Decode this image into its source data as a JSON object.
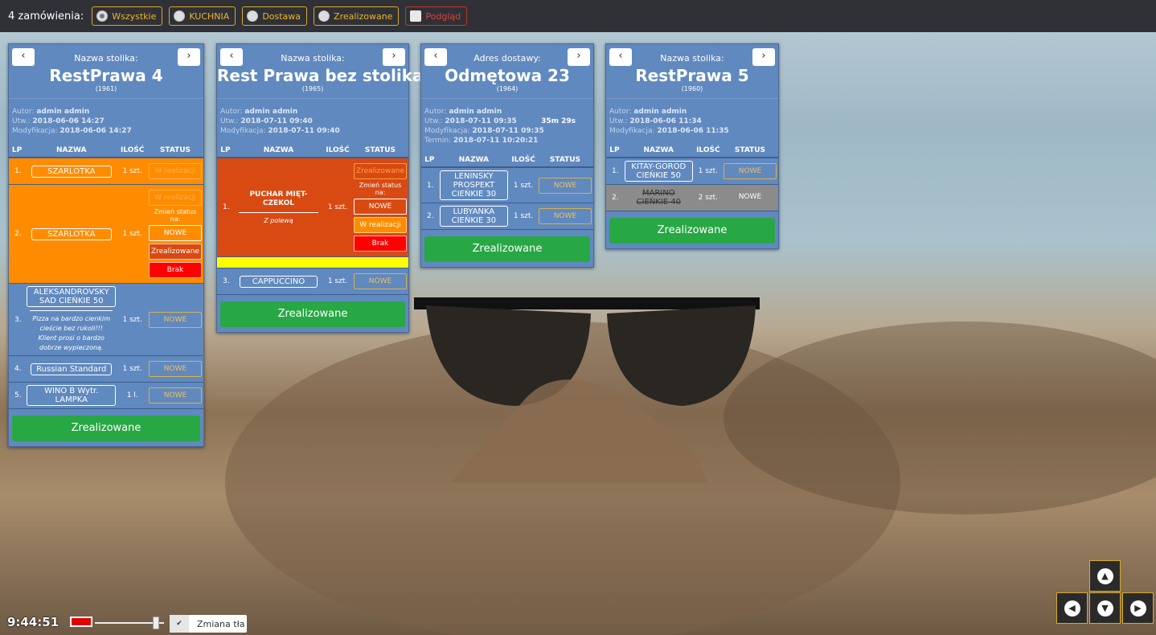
{
  "topbar": {
    "count_label": "4 zamówienia:",
    "filters": [
      {
        "label": "Wszystkie",
        "type": "radio",
        "selected": true
      },
      {
        "label": "KUCHNIA",
        "type": "radio",
        "selected": false
      },
      {
        "label": "Dostawa",
        "type": "radio",
        "selected": false
      },
      {
        "label": "Zrealizowane",
        "type": "radio",
        "selected": false
      },
      {
        "label": "Podgląd",
        "type": "checkbox",
        "selected": false
      }
    ]
  },
  "headers": {
    "lp": "LP",
    "name": "NAZWA",
    "qty": "ILOŚĆ",
    "status": "STATUS"
  },
  "nav": {
    "prev": "‹",
    "next": "›"
  },
  "cards": [
    {
      "label": "Nazwa stolika:",
      "title": "RestPrawa 4",
      "id": "(1961)",
      "meta": [
        {
          "k": "Autor:",
          "v": "admin admin"
        },
        {
          "k": "Utw.:",
          "v": "2018-06-06 14:27"
        },
        {
          "k": "Modyfikacja:",
          "v": "2018-06-06 14:27"
        }
      ],
      "items": [
        {
          "lp": "1.",
          "name": "SZARLOTKA",
          "qty": "1 szt.",
          "status": "W realizacji",
          "row": "orange",
          "btn": "faded"
        },
        {
          "lp": "2.",
          "name": "SZARLOTKA",
          "qty": "1 szt.",
          "status": "W realizacji",
          "row": "orange",
          "btn": "faded",
          "change_label": "Zmień status na:",
          "options": [
            {
              "label": "NOWE",
              "style": "white"
            },
            {
              "label": "Zrealizowane",
              "style": "redorange"
            },
            {
              "label": "Brak",
              "style": "red"
            }
          ]
        },
        {
          "lp": "3.",
          "name": "ALEKSANDROVSKY SAD CIEŃKIE 50",
          "note": "Pizza na bardzo cienkim cieście bez rukoli!!! Klient prosi o bardzo dobrze wypieczoną.",
          "qty": "1 szt.",
          "status": "NOWE"
        },
        {
          "lp": "4.",
          "name": "Russian Standard",
          "qty": "1 szt.",
          "status": "NOWE"
        },
        {
          "lp": "5.",
          "name": "WINO B Wytr. LAMPKA",
          "qty": "1 l.",
          "status": "NOWE"
        }
      ],
      "done": "Zrealizowane"
    },
    {
      "label": "Nazwa stolika:",
      "title": "Rest Prawa bez stolika",
      "id": "(1965)",
      "meta": [
        {
          "k": "Autor:",
          "v": "admin admin"
        },
        {
          "k": "Utw.:",
          "v": "2018-07-11 09:40"
        },
        {
          "k": "Modyfikacja:",
          "v": "2018-07-11 09:40"
        }
      ],
      "items": [
        {
          "lp": "1.",
          "name": "PUCHAR MIĘT-CZEKOL",
          "note": "Z polewą",
          "qty": "1 szt.",
          "status": "Zrealizowane",
          "row": "rust",
          "btn": "ltorange",
          "bold": true,
          "change_label": "Zmień status na:",
          "options": [
            {
              "label": "NOWE",
              "style": "white"
            },
            {
              "label": "W realizacji",
              "style": "orange"
            },
            {
              "label": "Brak",
              "style": "red"
            }
          ]
        },
        {
          "row": "yellow"
        },
        {
          "lp": "3.",
          "name": "CAPPUCCINO",
          "qty": "1 szt.",
          "status": "NOWE"
        }
      ],
      "done": "Zrealizowane"
    },
    {
      "label": "Adres dostawy:",
      "title": "Odmętowa 23",
      "id": "(1964)",
      "timer": "35m 29s",
      "meta": [
        {
          "k": "Autor:",
          "v": "admin admin"
        },
        {
          "k": "Utw.:",
          "v": "2018-07-11 09:35"
        },
        {
          "k": "Modyfikacja:",
          "v": "2018-07-11 09:35"
        },
        {
          "k": "Termin:",
          "v": "2018-07-11 10:20:21"
        }
      ],
      "items": [
        {
          "lp": "1.",
          "name": "LENINSKY PROSPEKT CIEŃKIE 30",
          "qty": "1 szt.",
          "status": "NOWE"
        },
        {
          "lp": "2.",
          "name": "LUBYANKA CIEŃKIE 30",
          "qty": "1 szt.",
          "status": "NOWE"
        }
      ],
      "done": "Zrealizowane"
    },
    {
      "label": "Nazwa stolika:",
      "title": "RestPrawa 5",
      "id": "(1960)",
      "meta": [
        {
          "k": "Autor:",
          "v": "admin admin"
        },
        {
          "k": "Utw.:",
          "v": "2018-06-06 11:34"
        },
        {
          "k": "Modyfikacja:",
          "v": "2018-06-06 11:35"
        }
      ],
      "items": [
        {
          "lp": "1.",
          "name": "KITAY-GOROD CIEŃKIE 50",
          "qty": "1 szt.",
          "status": "NOWE"
        },
        {
          "lp": "2.",
          "name": "MARINO CIEŃKIE 40",
          "qty": "2 szt.",
          "status": "NOWE",
          "row": "grey",
          "btn": "plain"
        }
      ],
      "done": "Zrealizowane"
    }
  ],
  "bottom": {
    "clock": "9:44:51",
    "bg_color": "#e00000",
    "bg_toggle_label": "Zmiana tła",
    "bg_toggle_check": "✔"
  },
  "arrows": {
    "up": "▲",
    "left": "◀",
    "down": "▼",
    "right": "▶"
  },
  "colors": {
    "card": "#6089bf",
    "done": "#28a745",
    "accent": "#d9a92a"
  }
}
